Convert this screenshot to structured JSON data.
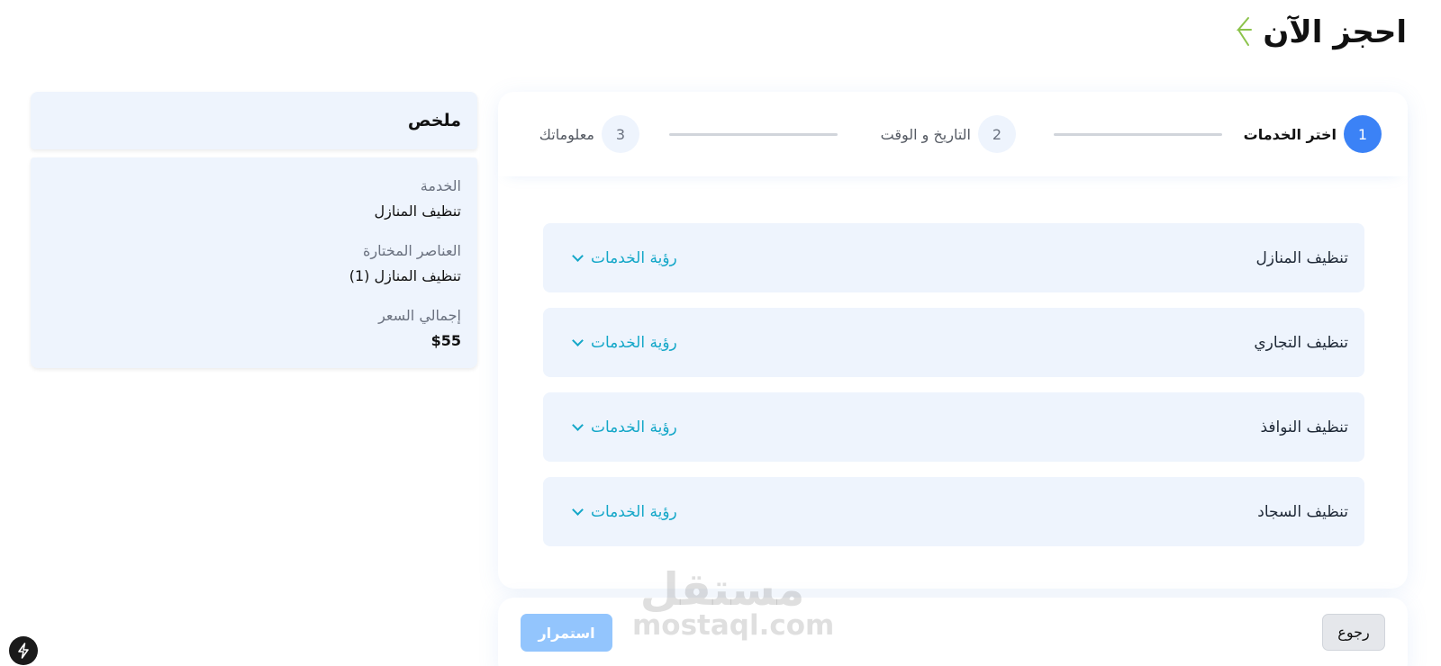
{
  "header": {
    "title": "احجز الآن",
    "arrow_icon": "arrow-icon"
  },
  "stepper": {
    "steps": [
      {
        "number": "1",
        "label": "اختر الخدمات",
        "active": true
      },
      {
        "number": "2",
        "label": "التاريخ و الوقت",
        "active": false
      },
      {
        "number": "3",
        "label": "معلوماتك",
        "active": false
      }
    ]
  },
  "services": [
    {
      "name": "تنظيف المنازل",
      "action_label": "رؤية الخدمات"
    },
    {
      "name": "تنظيف التجاري",
      "action_label": "رؤية الخدمات"
    },
    {
      "name": "تنظيف النوافذ",
      "action_label": "رؤية الخدمات"
    },
    {
      "name": "تنظيف السجاد",
      "action_label": "رؤية الخدمات"
    }
  ],
  "actions": {
    "back_label": "رجوع",
    "continue_label": "استمرار"
  },
  "summary": {
    "title": "ملخص",
    "service_label": "الخدمة",
    "service_value": "تنظيف المنازل",
    "items_label": "العناصر المختارة",
    "items_value": "تنظيف المنازل (1)",
    "total_label": "إجمالي السعر",
    "total_value": "$55"
  },
  "watermark": {
    "arabic": "مستقل",
    "latin": "mostaql.com"
  },
  "colors": {
    "accent": "#3b82f6",
    "link": "#14a7c8",
    "panel": "#eef4fd",
    "continue_disabled": "#93c5fd"
  }
}
